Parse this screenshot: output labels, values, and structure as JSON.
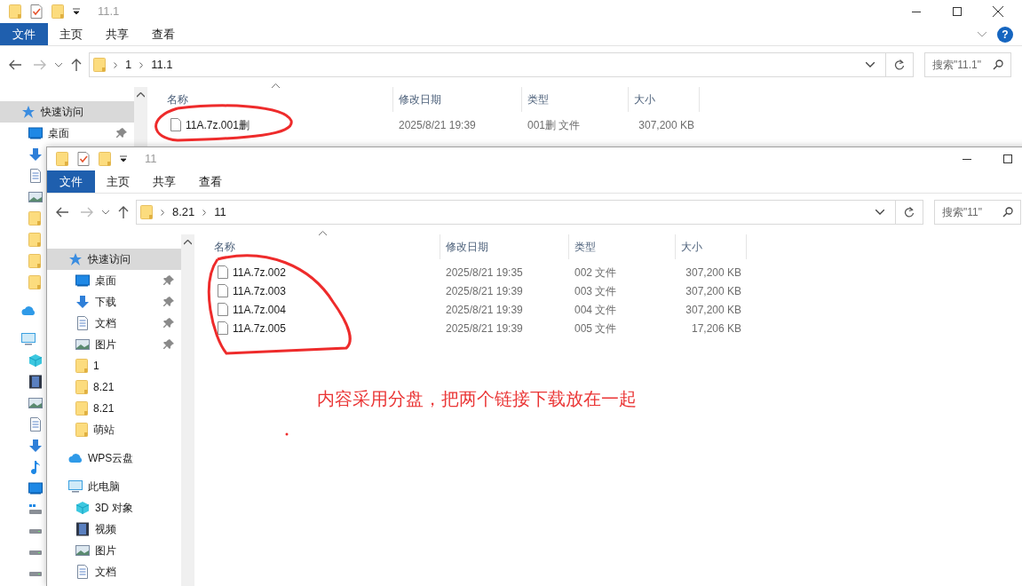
{
  "back_window": {
    "title": "11.1",
    "quick_access_toolbar": [
      {
        "kind": "folder"
      },
      {
        "kind": "properties"
      },
      {
        "kind": "folder"
      }
    ],
    "controls": [
      {
        "kind": "minimize"
      },
      {
        "kind": "maximize"
      },
      {
        "kind": "close"
      }
    ],
    "help_button": {
      "label": "?"
    },
    "ribbon_tabs": [
      {
        "label": "文件",
        "kind": "file_menu"
      },
      {
        "label": "主页",
        "kind": "tab"
      },
      {
        "label": "共享",
        "kind": "tab"
      },
      {
        "label": "查看",
        "kind": "tab"
      }
    ],
    "address": {
      "path": [
        "1",
        "11.1"
      ]
    },
    "search": {
      "placeholder": "搜索\"11.1\""
    },
    "sidebar": {
      "items": [
        {
          "kind": "quick_access",
          "label": "快速访问",
          "selected": true,
          "children": [
            {
              "kind": "desktop",
              "label": "桌面",
              "pinned": true
            },
            {
              "kind": "download"
            },
            {
              "kind": "document"
            },
            {
              "kind": "picture"
            },
            {
              "kind": "folder"
            },
            {
              "kind": "folder"
            },
            {
              "kind": "folder"
            },
            {
              "kind": "folder"
            }
          ]
        },
        {
          "kind": "cloud"
        },
        {
          "kind": "pc",
          "children": [
            {
              "kind": "cube"
            },
            {
              "kind": "video"
            },
            {
              "kind": "picture"
            },
            {
              "kind": "document"
            },
            {
              "kind": "download"
            },
            {
              "kind": "music"
            },
            {
              "kind": "desktop"
            },
            {
              "kind": "drive_windows"
            },
            {
              "kind": "drive"
            },
            {
              "kind": "drive"
            },
            {
              "kind": "drive"
            }
          ]
        }
      ]
    },
    "columns": [
      {
        "label": "名称",
        "sorted": true
      },
      {
        "label": "修改日期",
        "sorted": false
      },
      {
        "label": "类型",
        "sorted": false
      },
      {
        "label": "大小",
        "sorted": false
      }
    ],
    "files": [
      {
        "name": "11A.7z.001删",
        "modified": "2025/8/21 19:39",
        "type": "001删 文件",
        "size": "307,200 KB"
      }
    ]
  },
  "front_window": {
    "title": "11",
    "quick_access_toolbar": [
      {
        "kind": "folder"
      },
      {
        "kind": "properties"
      },
      {
        "kind": "folder"
      }
    ],
    "controls": [
      {
        "kind": "minimize"
      },
      {
        "kind": "maximize"
      }
    ],
    "ribbon_tabs": [
      {
        "label": "文件",
        "kind": "file_menu"
      },
      {
        "label": "主页",
        "kind": "tab"
      },
      {
        "label": "共享",
        "kind": "tab"
      },
      {
        "label": "查看",
        "kind": "tab"
      }
    ],
    "address": {
      "path": [
        "8.21",
        "11"
      ]
    },
    "search": {
      "placeholder": "搜索\"11\""
    },
    "sidebar": {
      "items": [
        {
          "kind": "quick_access",
          "label": "快速访问",
          "selected": true,
          "children": [
            {
              "kind": "desktop",
              "label": "桌面",
              "pinned": true
            },
            {
              "kind": "download",
              "label": "下载",
              "pinned": true
            },
            {
              "kind": "document",
              "label": "文档",
              "pinned": true
            },
            {
              "kind": "picture",
              "label": "图片",
              "pinned": true
            },
            {
              "kind": "folder",
              "label": "1",
              "pinned": false
            },
            {
              "kind": "folder",
              "label": "8.21",
              "pinned": false
            },
            {
              "kind": "folder",
              "label": "8.21",
              "pinned": false
            },
            {
              "kind": "folder",
              "label": "萌站",
              "pinned": false
            }
          ]
        },
        {
          "kind": "cloud",
          "label": "WPS云盘",
          "selected": false
        },
        {
          "kind": "pc",
          "label": "此电脑",
          "selected": false,
          "children": [
            {
              "kind": "cube",
              "label": "3D 对象"
            },
            {
              "kind": "video",
              "label": "视频"
            },
            {
              "kind": "picture",
              "label": "图片"
            },
            {
              "kind": "document",
              "label": "文档"
            }
          ]
        }
      ]
    },
    "columns": [
      {
        "label": "名称",
        "sorted": true
      },
      {
        "label": "修改日期",
        "sorted": false
      },
      {
        "label": "类型",
        "sorted": false
      },
      {
        "label": "大小",
        "sorted": false
      }
    ],
    "files": [
      {
        "name": "11A.7z.002",
        "modified": "2025/8/21 19:35",
        "type": "002 文件",
        "size": "307,200 KB"
      },
      {
        "name": "11A.7z.003",
        "modified": "2025/8/21 19:39",
        "type": "003 文件",
        "size": "307,200 KB"
      },
      {
        "name": "11A.7z.004",
        "modified": "2025/8/21 19:39",
        "type": "004 文件",
        "size": "307,200 KB"
      },
      {
        "name": "11A.7z.005",
        "modified": "2025/8/21 19:39",
        "type": "005 文件",
        "size": "17,206 KB"
      }
    ]
  },
  "annotation": {
    "note": "内容采用分盘，把两个链接下载放在一起"
  }
}
